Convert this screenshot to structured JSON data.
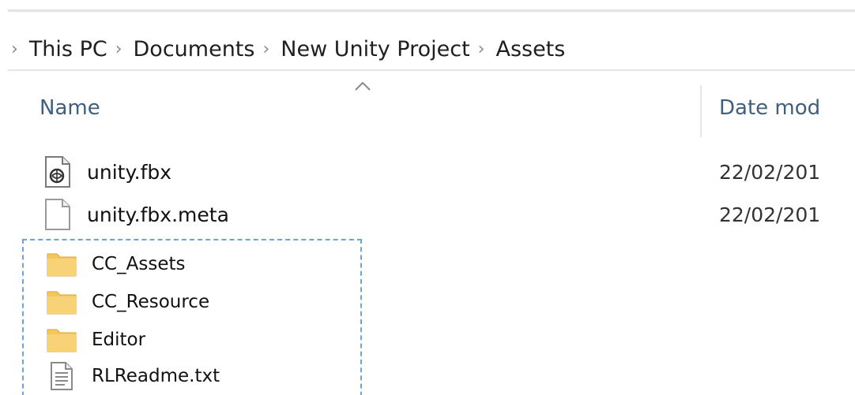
{
  "breadcrumb": {
    "separator": "›",
    "items": [
      "This PC",
      "Documents",
      "New Unity Project",
      "Assets"
    ]
  },
  "columns": {
    "name": "Name",
    "date_modified": "Date mod"
  },
  "files": [
    {
      "name": "unity.fbx",
      "date": "22/02/201",
      "icon": "fbx-file-icon"
    },
    {
      "name": "unity.fbx.meta",
      "date": "22/02/201",
      "icon": "blank-file-icon"
    },
    {
      "name": "CC_Assets",
      "icon": "folder-icon"
    },
    {
      "name": "CC_Resource",
      "icon": "folder-icon"
    },
    {
      "name": "Editor",
      "icon": "folder-icon"
    },
    {
      "name": "RLReadme.txt",
      "icon": "text-file-icon"
    }
  ],
  "colors": {
    "header_text": "#3f5f7f",
    "folder": "#f2c55c",
    "selection_border": "#6fa3d6"
  }
}
